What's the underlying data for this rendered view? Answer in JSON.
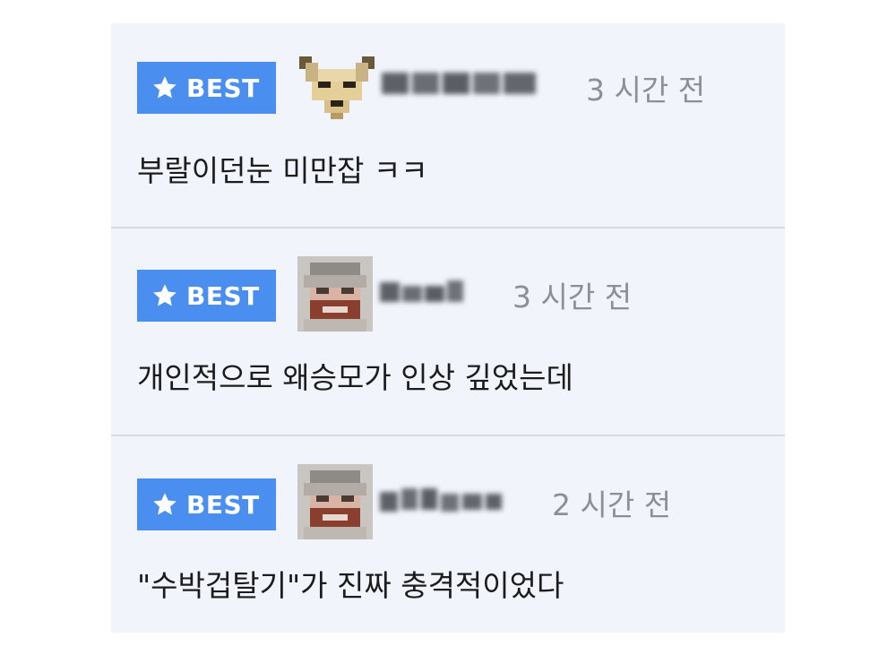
{
  "comments": [
    {
      "badge": "BEST",
      "username": "",
      "time": "3 시간 전",
      "text": "부랄이던눈 미만잡 ㅋㅋ"
    },
    {
      "badge": "BEST",
      "username": "",
      "time": "3 시간 전",
      "text": "개인적으로 왜승모가 인상 깊었는데"
    },
    {
      "badge": "BEST",
      "username": "",
      "time": "2 시간 전",
      "text": "\"수박겁탈기\"가 진짜 충격적이었다"
    }
  ],
  "colors": {
    "badge_bg": "#4a8ff0",
    "panel_bg": "#f1f5fb",
    "timestamp": "#8c9096",
    "text": "#1c1c1c",
    "divider": "#d3dae3"
  },
  "icons": {
    "badge_icon": "star-icon",
    "avatar_1": "dog-avatar-pixelated",
    "avatar_2": "face-avatar-pixelated",
    "avatar_3": "face-avatar-pixelated"
  }
}
